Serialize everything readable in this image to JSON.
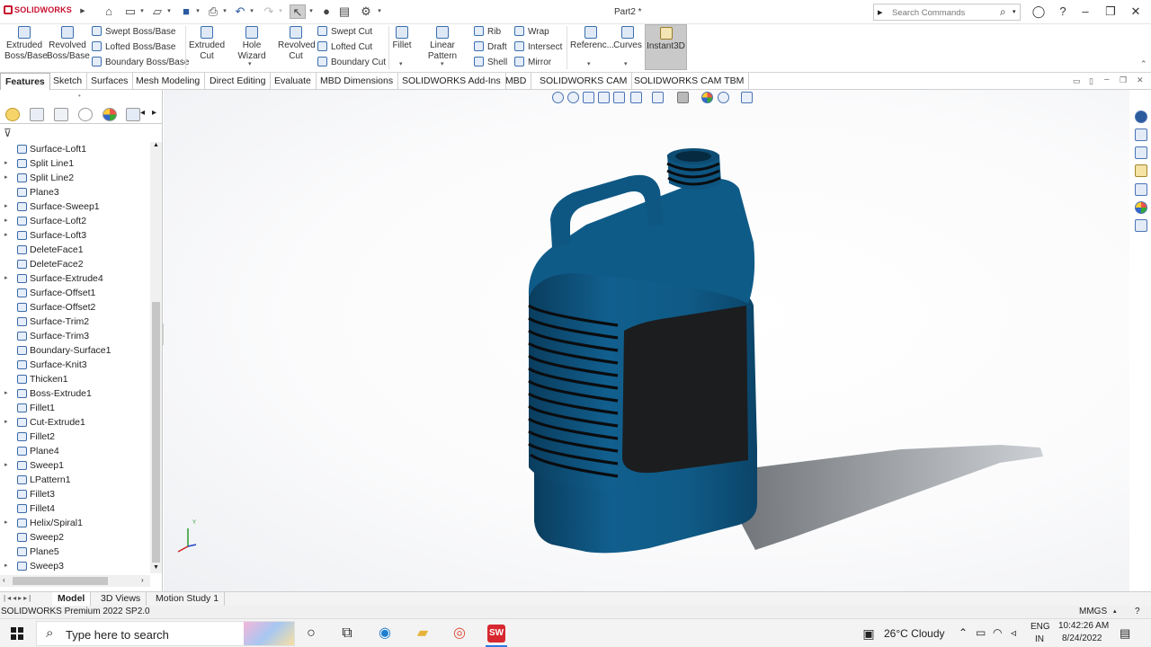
{
  "app": {
    "brand": "SOLIDWORKS",
    "document_title": "Part2 *"
  },
  "search": {
    "placeholder": "Search Commands"
  },
  "ribbon": {
    "extruded_boss": "Extruded\nBoss/Base",
    "revolved_boss": "Revolved\nBoss/Base",
    "swept_boss": "Swept Boss/Base",
    "lofted_boss": "Lofted Boss/Base",
    "boundary_boss": "Boundary Boss/Base",
    "extruded_cut": "Extruded\nCut",
    "hole_wizard": "Hole Wizard",
    "revolved_cut": "Revolved\nCut",
    "swept_cut": "Swept Cut",
    "lofted_cut": "Lofted Cut",
    "boundary_cut": "Boundary Cut",
    "fillet": "Fillet",
    "linear_pattern": "Linear Pattern",
    "rib": "Rib",
    "draft": "Draft",
    "shell": "Shell",
    "wrap": "Wrap",
    "intersect": "Intersect",
    "mirror": "Mirror",
    "reference": "Referenc...",
    "curves": "Curves",
    "instant3d": "Instant3D"
  },
  "tabs": [
    "Features",
    "Sketch",
    "Surfaces",
    "Mesh Modeling",
    "Direct Editing",
    "Evaluate",
    "MBD Dimensions",
    "SOLIDWORKS Add-Ins",
    "MBD",
    "SOLIDWORKS CAM",
    "SOLIDWORKS CAM TBM"
  ],
  "tree": [
    {
      "label": "Surface-Loft1",
      "expand": false
    },
    {
      "label": "Split Line1",
      "expand": true
    },
    {
      "label": "Split Line2",
      "expand": true
    },
    {
      "label": "Plane3",
      "expand": false
    },
    {
      "label": "Surface-Sweep1",
      "expand": true
    },
    {
      "label": "Surface-Loft2",
      "expand": true
    },
    {
      "label": "Surface-Loft3",
      "expand": true
    },
    {
      "label": "DeleteFace1",
      "expand": false
    },
    {
      "label": "DeleteFace2",
      "expand": false
    },
    {
      "label": "Surface-Extrude4",
      "expand": true
    },
    {
      "label": "Surface-Offset1",
      "expand": false
    },
    {
      "label": "Surface-Offset2",
      "expand": false
    },
    {
      "label": "Surface-Trim2",
      "expand": false
    },
    {
      "label": "Surface-Trim3",
      "expand": false
    },
    {
      "label": "Boundary-Surface1",
      "expand": false
    },
    {
      "label": "Surface-Knit3",
      "expand": false
    },
    {
      "label": "Thicken1",
      "expand": false
    },
    {
      "label": "Boss-Extrude1",
      "expand": true
    },
    {
      "label": "Fillet1",
      "expand": false
    },
    {
      "label": "Cut-Extrude1",
      "expand": true
    },
    {
      "label": "Fillet2",
      "expand": false
    },
    {
      "label": "Plane4",
      "expand": false
    },
    {
      "label": "Sweep1",
      "expand": true
    },
    {
      "label": "LPattern1",
      "expand": false
    },
    {
      "label": "Fillet3",
      "expand": false
    },
    {
      "label": "Fillet4",
      "expand": false
    },
    {
      "label": "Helix/Spiral1",
      "expand": true
    },
    {
      "label": "Sweep2",
      "expand": false
    },
    {
      "label": "Plane5",
      "expand": false
    },
    {
      "label": "Sweep3",
      "expand": true
    }
  ],
  "bottom_tabs": {
    "model": "Model",
    "views": "3D Views",
    "motion": "Motion Study 1"
  },
  "status": {
    "product": "SOLIDWORKS Premium 2022 SP2.0",
    "units": "MMGS"
  },
  "triad": {
    "y": "Y"
  },
  "taskbar": {
    "search_placeholder": "Type here to search",
    "weather": "26°C  Cloudy",
    "lang1": "ENG",
    "lang2": "IN",
    "time": "10:42:26 AM",
    "date": "8/24/2022"
  },
  "colors": {
    "jug": "#0f5a86",
    "label": "#1c1d1f",
    "ribbon_active": "#c9c9c9"
  }
}
